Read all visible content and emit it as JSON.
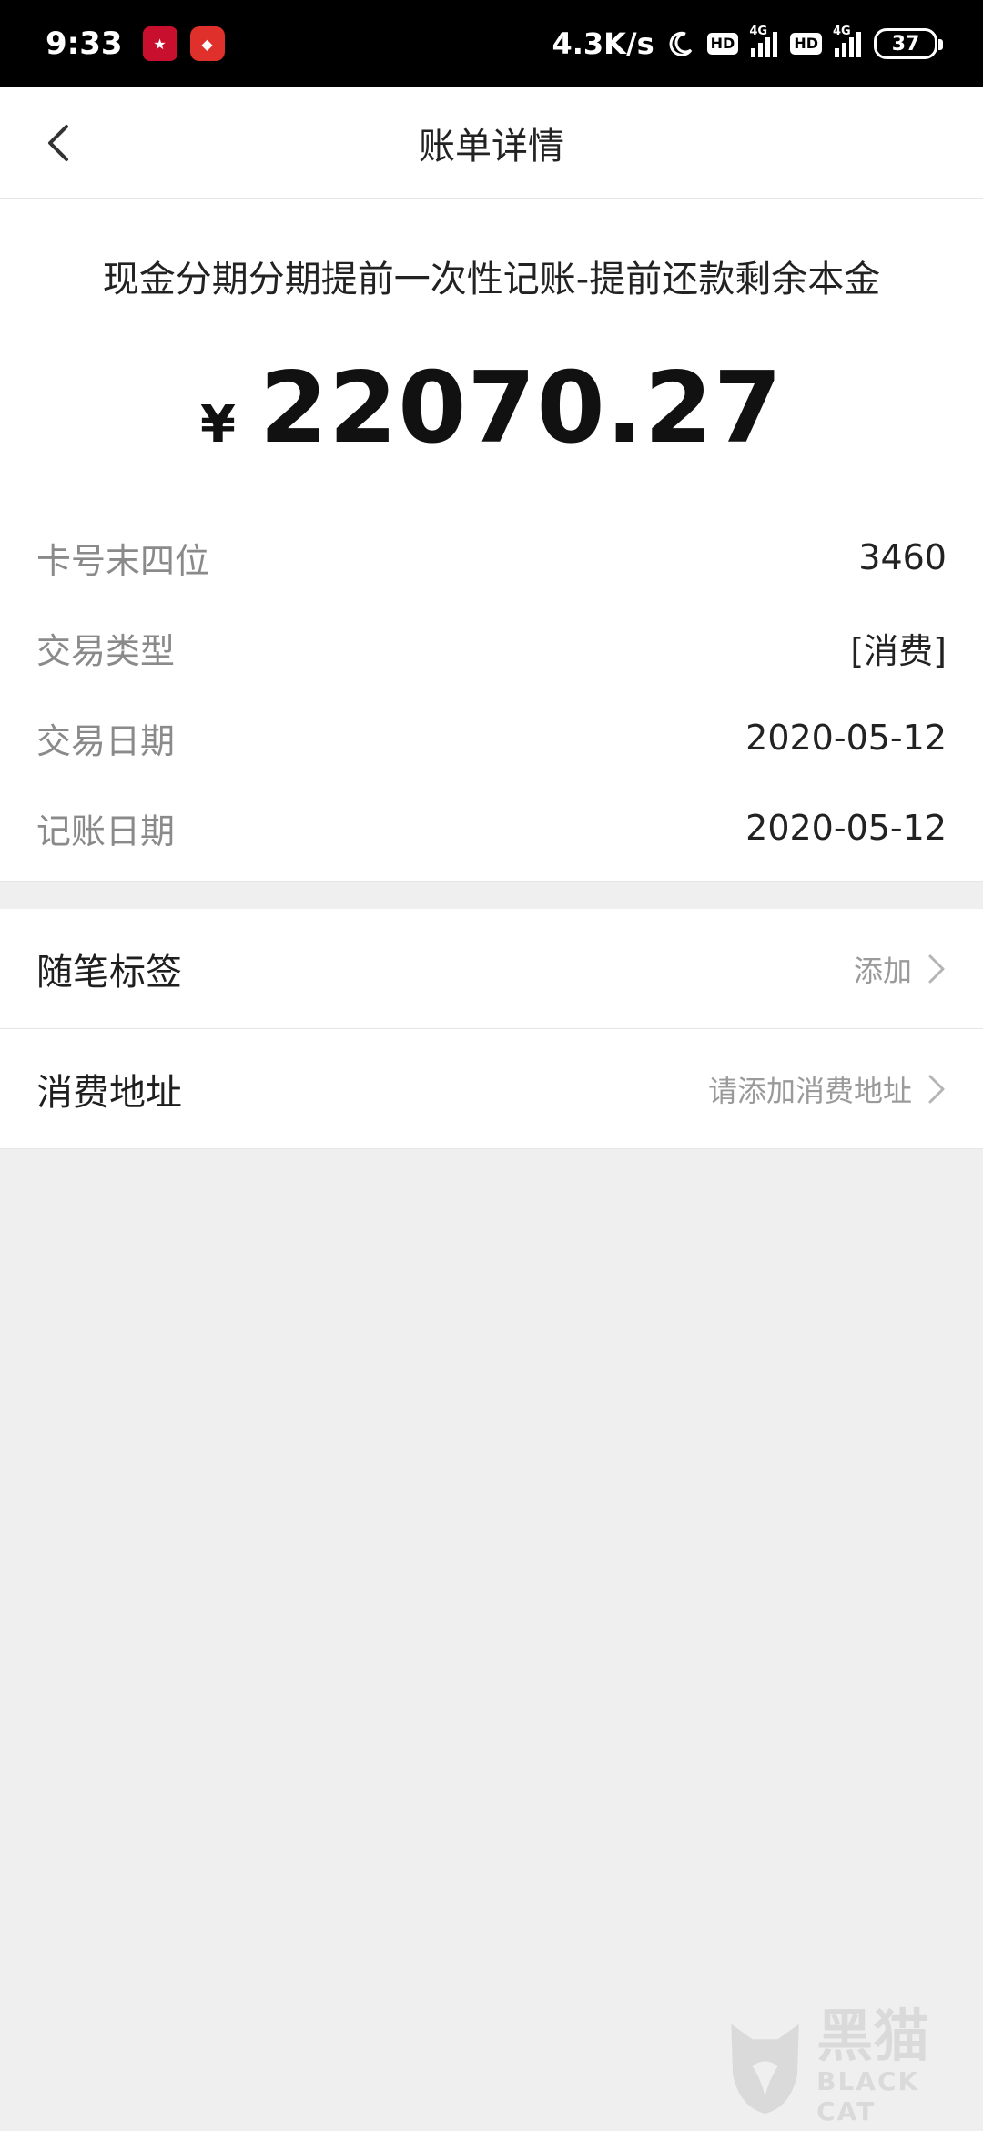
{
  "status_bar": {
    "time": "9:33",
    "app_icons": [
      "news-app-icon",
      "shopping-app-icon"
    ],
    "net_speed": "4.3K/s",
    "hd_1": "HD",
    "net_1": "4G",
    "hd_2": "HD",
    "net_2": "4G",
    "battery": "37"
  },
  "nav": {
    "title": "账单详情",
    "back_icon": "chevron-left-icon"
  },
  "detail": {
    "description": "现金分期分期提前一次性记账-提前还款剩余本金",
    "currency": "¥",
    "amount": "22070.27",
    "rows": [
      {
        "label": "卡号末四位",
        "value": "3460"
      },
      {
        "label": "交易类型",
        "value": "[消费]"
      },
      {
        "label": "交易日期",
        "value": "2020-05-12"
      },
      {
        "label": "记账日期",
        "value": "2020-05-12"
      }
    ]
  },
  "options": [
    {
      "label": "随笔标签",
      "hint": "添加",
      "icon": "chevron-right-icon"
    },
    {
      "label": "消费地址",
      "hint": "请添加消费地址",
      "icon": "chevron-right-icon"
    }
  ],
  "watermark": {
    "cn": "黑猫",
    "en": "BLACK CAT",
    "icon": "black-cat-logo-icon"
  },
  "colors": {
    "background": "#efefef",
    "card": "#ffffff",
    "label_gray": "#8a8a8a",
    "hint_gray": "#9a9a9a"
  }
}
